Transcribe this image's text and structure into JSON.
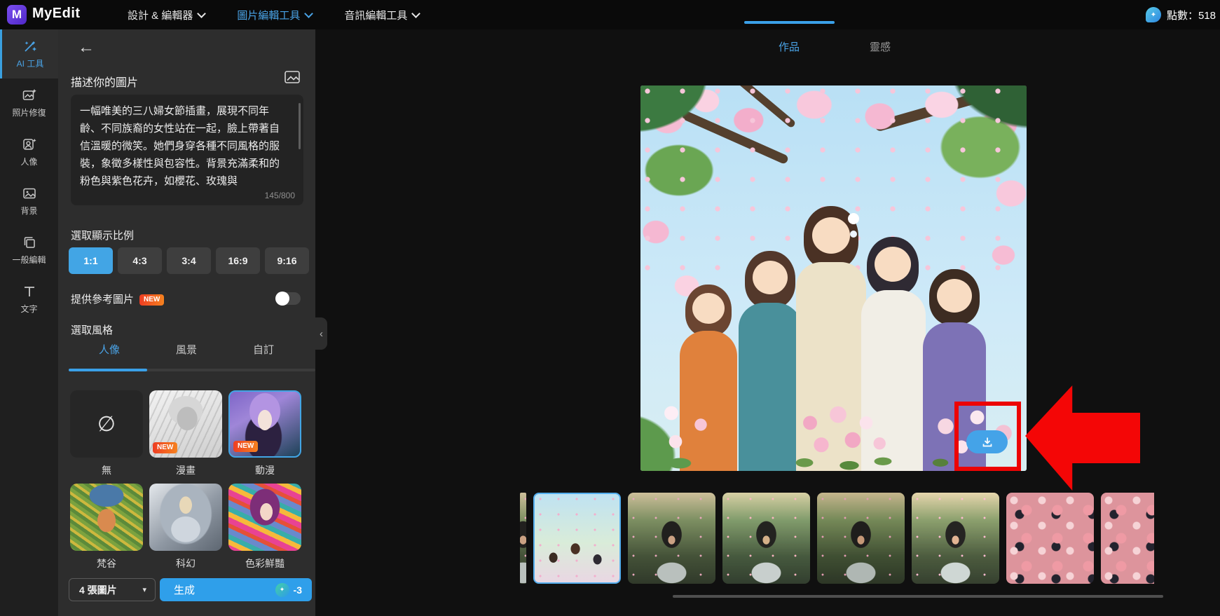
{
  "topbar": {
    "brand": "MyEdit",
    "logo_letter": "M",
    "nav": [
      {
        "label": "設計 & 編輯器"
      },
      {
        "label": "圖片編輯工具"
      },
      {
        "label": "音訊編輯工具"
      }
    ],
    "points": "點數：518",
    "coin_glyph": "✦"
  },
  "sidebar": {
    "items": [
      {
        "label": "AI 工具",
        "icon": "magic-wand-icon",
        "active": true
      },
      {
        "label": "照片修復",
        "icon": "photo-restore-icon"
      },
      {
        "label": "人像",
        "icon": "portrait-icon"
      },
      {
        "label": "背景",
        "icon": "background-icon"
      },
      {
        "label": "一般編輯",
        "icon": "general-edit-icon"
      },
      {
        "label": "文字",
        "icon": "text-icon"
      }
    ]
  },
  "panel": {
    "back_glyph": "←",
    "prompt_label": "描述你的圖片",
    "prompt_text": "一幅唯美的三八婦女節插畫，展現不同年齡、不同族裔的女性站在一起，臉上帶著自信溫暖的微笑。她們身穿各種不同風格的服裝，象徵多樣性與包容性。背景充滿柔和的粉色與紫色花卉，如櫻花、玫瑰與",
    "char_counter": "145/800",
    "ratio_label": "選取顯示比例",
    "ratios": [
      "1:1",
      "4:3",
      "3:4",
      "16:9",
      "9:16"
    ],
    "active_ratio": "1:1",
    "reference_label": "提供參考圖片",
    "new_badge": "NEW",
    "reference_toggle": "off",
    "style_label": "選取風格",
    "style_tabs": [
      {
        "label": "人像",
        "active": true
      },
      {
        "label": "風景"
      },
      {
        "label": "自訂"
      }
    ],
    "styles": [
      {
        "name": "無",
        "glyph": "∅"
      },
      {
        "name": "漫畫",
        "badge": "NEW"
      },
      {
        "name": "動漫",
        "badge": "NEW",
        "selected": true
      },
      {
        "name": "梵谷"
      },
      {
        "name": "科幻"
      },
      {
        "name": "色彩鮮豔"
      }
    ],
    "image_count": "4 張圖片",
    "dropdown_caret": "▾",
    "generate_label": "生成",
    "generate_cost": "-3",
    "collapse_glyph": "‹"
  },
  "main": {
    "tabs": [
      {
        "label": "作品",
        "active": true
      },
      {
        "label": "靈感"
      }
    ],
    "thumbnails": [
      "anime-group",
      "garden-portrait",
      "garden-portrait",
      "garden-portrait",
      "garden-portrait",
      "floral-pattern",
      "floral-pattern"
    ]
  },
  "colors": {
    "accent_blue": "#42a5e5",
    "generate_blue": "#2f9fea",
    "badge_gradient_from": "#ee3d23",
    "badge_gradient_to": "#f5821f",
    "annotation_red": "#ec0404"
  }
}
